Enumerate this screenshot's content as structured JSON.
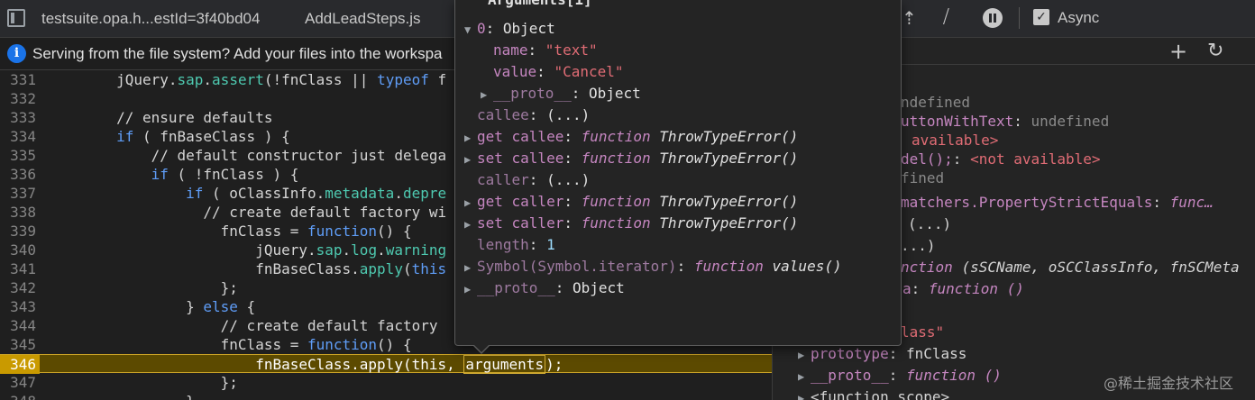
{
  "tabs": {
    "tab1": "testsuite.opa.h...estId=3f40bd04",
    "tab2": "AddLeadSteps.js"
  },
  "toolbar": {
    "async_label": "Async",
    "async_checked": "✓"
  },
  "infobar": {
    "text": "Serving from the file system? Add your files into the workspa"
  },
  "editor": {
    "lines": [
      {
        "n": "331"
      },
      {
        "n": "332"
      },
      {
        "n": "333"
      },
      {
        "n": "334"
      },
      {
        "n": "335"
      },
      {
        "n": "336"
      },
      {
        "n": "337"
      },
      {
        "n": "338"
      },
      {
        "n": "339"
      },
      {
        "n": "340"
      },
      {
        "n": "341"
      },
      {
        "n": "342"
      },
      {
        "n": "343"
      },
      {
        "n": "344"
      },
      {
        "n": "345"
      },
      {
        "n": "346"
      },
      {
        "n": "347"
      },
      {
        "n": "348"
      }
    ],
    "active_line": "346"
  },
  "popover": {
    "title": "Arguments[1]",
    "rows": [
      {
        "key": "0",
        "sep": ": ",
        "val": "Object"
      },
      {
        "key": "name",
        "sep": ": ",
        "val": "\"text\""
      },
      {
        "key": "value",
        "sep": ": ",
        "val": "\"Cancel\""
      },
      {
        "key": "__proto__",
        "sep": ": ",
        "val": "Object"
      },
      {
        "key": "callee",
        "sep": ": ",
        "val": "(...)"
      },
      {
        "key": "get callee",
        "sep": ": ",
        "fn": "function",
        "val": "ThrowTypeError()"
      },
      {
        "key": "set callee",
        "sep": ": ",
        "fn": "function",
        "val": "ThrowTypeError()"
      },
      {
        "key": "caller",
        "sep": ": ",
        "val": "(...)"
      },
      {
        "key": "get caller",
        "sep": ": ",
        "fn": "function",
        "val": "ThrowTypeError()"
      },
      {
        "key": "set caller",
        "sep": ": ",
        "fn": "function",
        "val": "ThrowTypeError()"
      },
      {
        "key": "length",
        "sep": ": ",
        "val": "1"
      },
      {
        "key": "Symbol(Symbol.iterator)",
        "sep": ": ",
        "fn": "function",
        "val": "values()"
      },
      {
        "key": "__proto__",
        "sep": ": ",
        "val": "Object"
      }
    ]
  },
  "scope": {
    "lines": [
      {
        "a": "s"
      },
      {
        "a": "ndefined"
      },
      {
        "a": "uttonWithText",
        "b": ": ",
        "c": "undefined"
      },
      {
        "a": "available>"
      },
      {
        "a": "del();",
        "b": ": ",
        "c": "<not available>"
      },
      {
        "a": "fined"
      },
      {
        "a": "matchers.PropertyStrictEquals",
        "b": ": ",
        "c": "func…"
      },
      {
        "a": "(...)"
      },
      {
        "a": "...)"
      },
      {
        "a": "nction",
        "b": " ",
        "c": "(sSCName, oSCClassInfo, fnSCMeta"
      },
      {
        "a": "a",
        "b": ": ",
        "c": "function ()"
      },
      {
        "a": "lass\""
      },
      {
        "a": "prototype",
        "b": ": ",
        "c": "fnClass"
      },
      {
        "a": "__proto__",
        "b": ": ",
        "c": "function ()"
      },
      {
        "a": "<function scope>"
      }
    ]
  },
  "watermark": "@稀土掘金技术社区"
}
